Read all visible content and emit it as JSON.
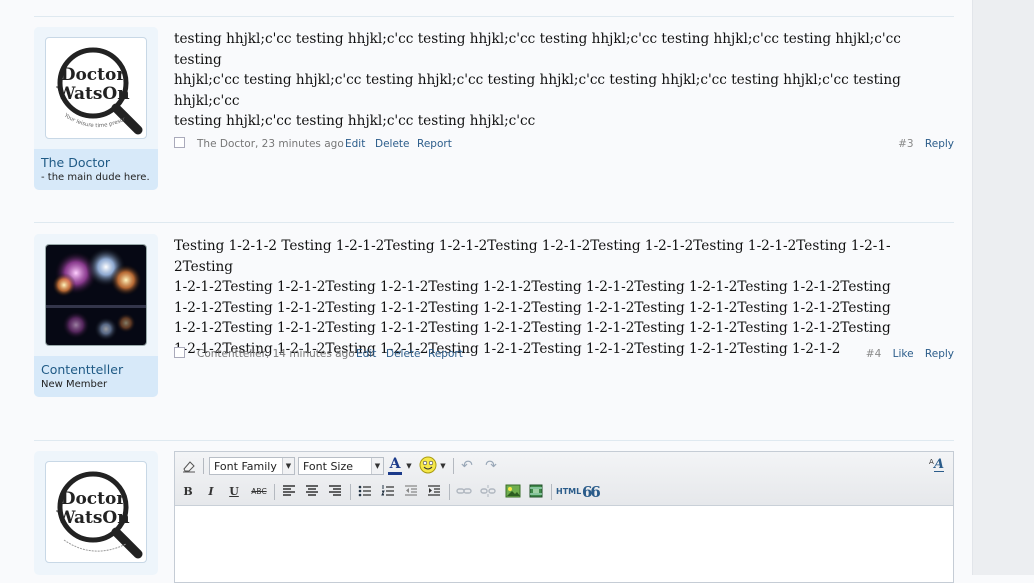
{
  "posts": [
    {
      "username": "The Doctor",
      "user_title": "- the main dude here.",
      "avatar_line1": "Doctor",
      "avatar_line2": "WatsOn",
      "avatar_tagline": "Your leisure time prescription",
      "message_lines": [
        "testing hhjkl;c'cc testing hhjkl;c'cc testing hhjkl;c'cc testing hhjkl;c'cc testing hhjkl;c'cc testing hhjkl;c'cc testing",
        "hhjkl;c'cc testing hhjkl;c'cc testing hhjkl;c'cc testing hhjkl;c'cc testing hhjkl;c'cc testing hhjkl;c'cc testing hhjkl;c'cc",
        "testing hhjkl;c'cc testing hhjkl;c'cc testing hhjkl;c'cc"
      ],
      "meta_author": "The Doctor, 23 minutes ago",
      "edit": "Edit",
      "delete": "Delete",
      "report": "Report",
      "post_number": "#3",
      "reply": "Reply"
    },
    {
      "username": "Contentteller",
      "user_title": "New Member",
      "message_lines": [
        "Testing 1-2-1-2 Testing 1-2-1-2Testing 1-2-1-2Testing 1-2-1-2Testing 1-2-1-2Testing 1-2-1-2Testing 1-2-1-2Testing",
        "1-2-1-2Testing 1-2-1-2Testing 1-2-1-2Testing 1-2-1-2Testing 1-2-1-2Testing 1-2-1-2Testing 1-2-1-2Testing",
        "1-2-1-2Testing 1-2-1-2Testing 1-2-1-2Testing 1-2-1-2Testing 1-2-1-2Testing 1-2-1-2Testing 1-2-1-2Testing",
        "1-2-1-2Testing 1-2-1-2Testing 1-2-1-2Testing 1-2-1-2Testing 1-2-1-2Testing 1-2-1-2Testing 1-2-1-2Testing",
        "1-2-1-2Testing 1-2-1-2Testing 1-2-1-2Testing 1-2-1-2Testing 1-2-1-2Testing 1-2-1-2Testing 1-2-1-2"
      ],
      "meta_author": "Contentteller, 14 minutes ago",
      "edit": "Edit",
      "delete": "Delete",
      "report": "Report",
      "post_number": "#4",
      "like": "Like",
      "reply": "Reply"
    }
  ],
  "editor": {
    "font_family_label": "Font Family",
    "font_size_label": "Font Size",
    "bold": "B",
    "italic": "I",
    "underline": "U",
    "strike": "ABC",
    "html_label": "HTML",
    "quote_glyph": "66",
    "text_color_glyph": "A",
    "switch_mode_glyph": "A",
    "accent_color": "#2b5c8a"
  },
  "reply_avatar": {
    "line1": "Doctor",
    "line2": "WatsOn"
  }
}
